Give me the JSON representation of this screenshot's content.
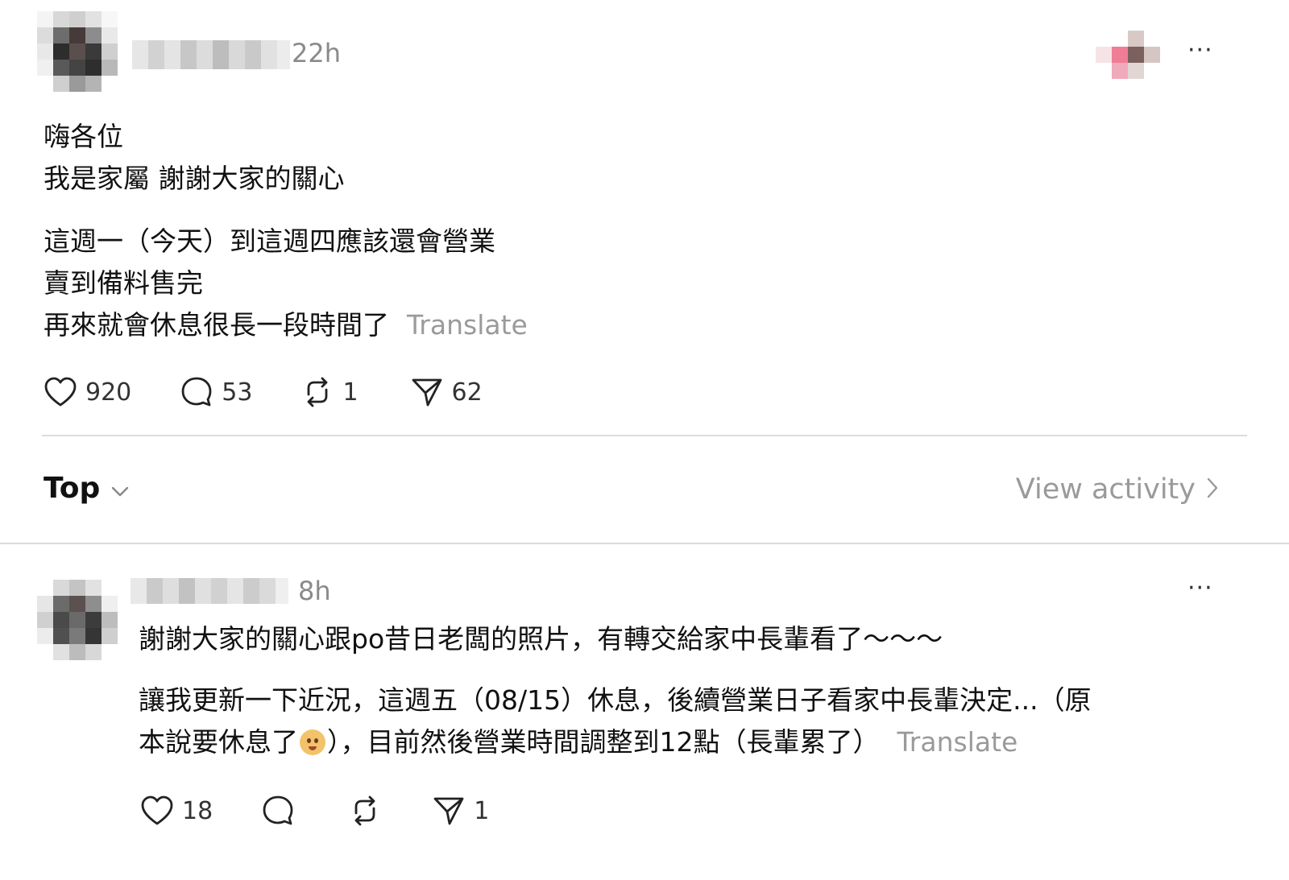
{
  "post": {
    "time": "22h",
    "more_label": "···",
    "lines_block1": [
      "嗨各位",
      "我是家屬 謝謝大家的關心"
    ],
    "lines_block2": [
      "這週一（今天）到這週四應該還會營業",
      "賣到備料售完"
    ],
    "last_line": "再來就會休息很長一段時間了",
    "translate_label": "Translate",
    "likes": "920",
    "comments": "53",
    "reposts": "1",
    "shares": "62"
  },
  "thread": {
    "sort_label": "Top",
    "view_activity_label": "View activity"
  },
  "reply": {
    "time": "8h",
    "more_label": "···",
    "line1": "謝謝大家的關心跟po昔日老闆的照片，有轉交給家中長輩看了～～～",
    "line2": "讓我更新一下近況，這週五（08/15）休息，後續營業日子看家中長輩決定...（原",
    "line3_before_emoji": "本說要休息了",
    "line3_after_emoji": "），目前然後營業時間調整到12點（長輩累了）",
    "translate_label": "Translate",
    "likes": "18",
    "shares": "1"
  },
  "icons": {
    "like": "heart-icon",
    "comment": "comment-bubble-icon",
    "repost": "repost-icon",
    "share": "share-send-icon",
    "sort_dropdown": "chevron-down-icon",
    "view_activity": "chevron-right-icon",
    "more": "more-horizontal-icon",
    "emoji": "pleading-face-emoji"
  },
  "colors": {
    "text": "#111111",
    "muted": "#9a9a9a",
    "divider": "#dcdcdc"
  }
}
